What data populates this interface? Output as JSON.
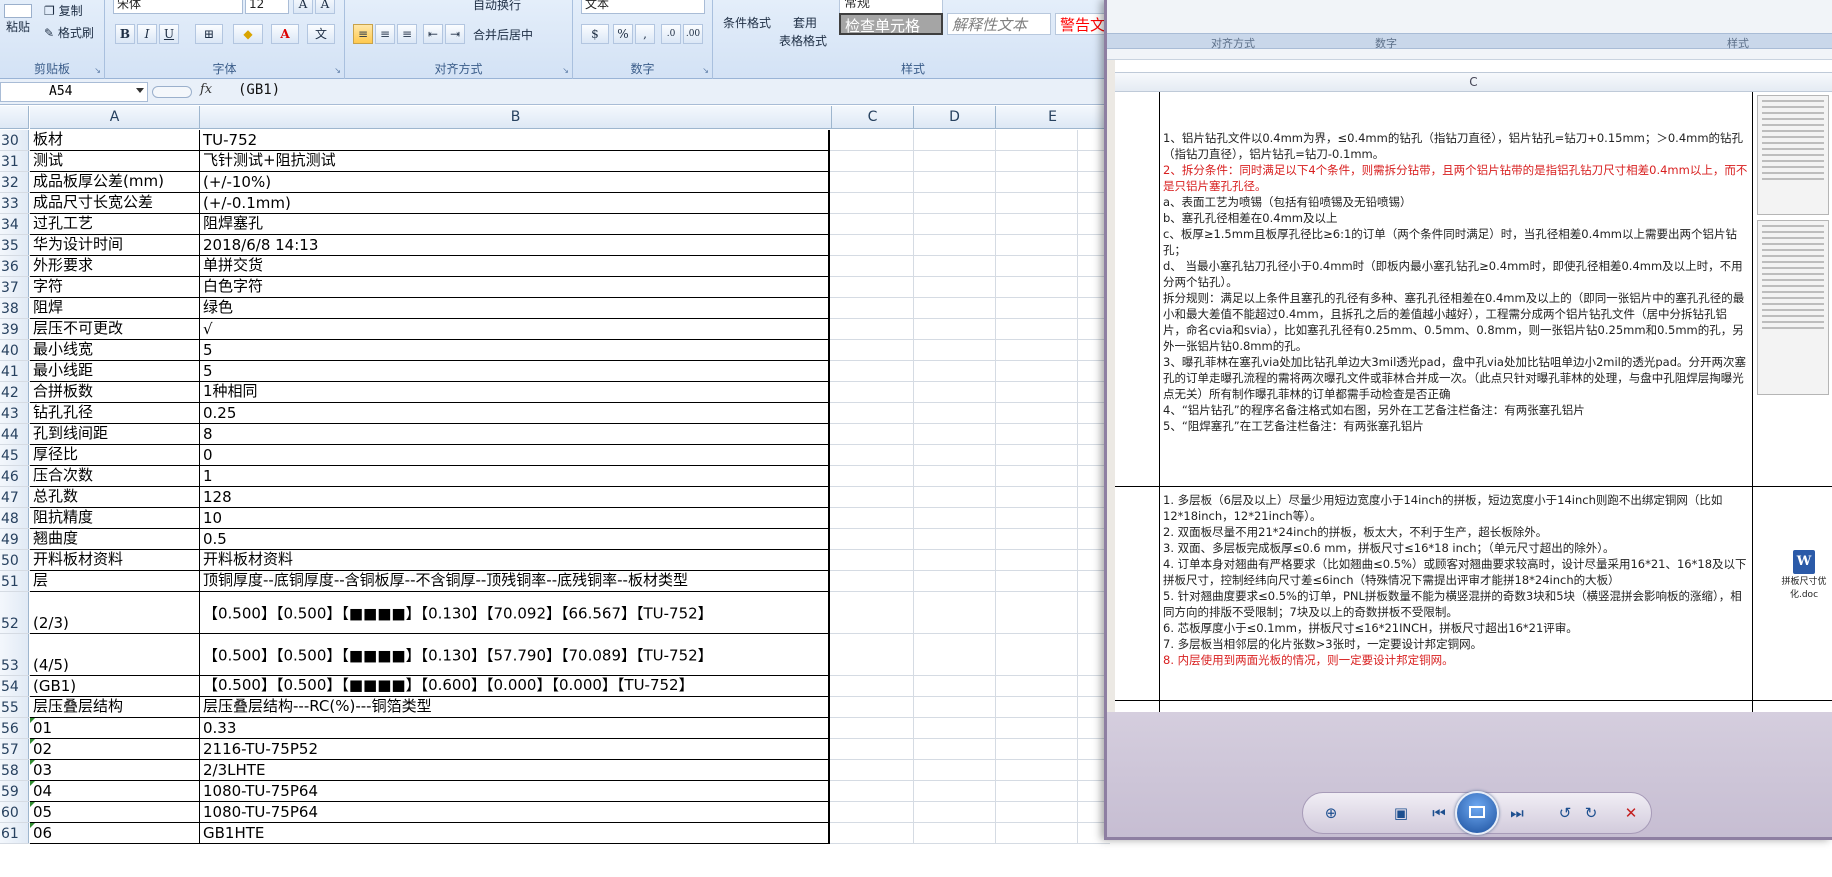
{
  "ribbon": {
    "font_name": "宋体",
    "font_size": "12",
    "number_format": "文本",
    "paste_label": "粘贴",
    "copy_label": "复制",
    "format_painter_label": "格式刷",
    "wrap_label": "自动换行",
    "merge_center_label": "合并后居中",
    "cond_format_label": "条件格式",
    "table_format_label": "套用",
    "table_format_label2": "表格格式",
    "style_normal": "常规",
    "style_check_cell": "检查单元格",
    "style_explanatory": "解释性文本",
    "style_warning": "警告文",
    "groups": {
      "clipboard": "剪贴板",
      "font": "字体",
      "alignment": "对齐方式",
      "number": "数字",
      "styles": "样式"
    },
    "bold": "B",
    "italic": "I",
    "underline": "U",
    "percent": "%",
    "comma": ","
  },
  "formula_bar": {
    "cell_ref": "A54",
    "fx": "fx",
    "content": "(GB1)"
  },
  "columns": [
    "A",
    "B",
    "C",
    "D",
    "E"
  ],
  "rows": [
    {
      "n": "30",
      "a": "板材",
      "b": "TU-752"
    },
    {
      "n": "31",
      "a": "测试",
      "b": "飞针测试+阻抗测试"
    },
    {
      "n": "32",
      "a": "成品板厚公差(mm)",
      "b": "(+/-10%)"
    },
    {
      "n": "33",
      "a": "成品尺寸长宽公差",
      "b": "(+/-0.1mm)"
    },
    {
      "n": "34",
      "a": "过孔工艺",
      "b": "阻焊塞孔"
    },
    {
      "n": "35",
      "a": "华为设计时间",
      "b": "2018/6/8 14:13"
    },
    {
      "n": "36",
      "a": "外形要求",
      "b": "单拼交货"
    },
    {
      "n": "37",
      "a": "字符",
      "b": "白色字符"
    },
    {
      "n": "38",
      "a": "阻焊",
      "b": "绿色"
    },
    {
      "n": "39",
      "a": "层压不可更改",
      "b": "√"
    },
    {
      "n": "40",
      "a": "最小线宽",
      "b": "5"
    },
    {
      "n": "41",
      "a": "最小线距",
      "b": "5"
    },
    {
      "n": "42",
      "a": "合拼板数",
      "b": "1种相同"
    },
    {
      "n": "43",
      "a": "钻孔孔径",
      "b": "0.25"
    },
    {
      "n": "44",
      "a": "孔到线间距",
      "b": "8"
    },
    {
      "n": "45",
      "a": "厚径比",
      "b": "0"
    },
    {
      "n": "46",
      "a": "压合次数",
      "b": "1"
    },
    {
      "n": "47",
      "a": "总孔数",
      "b": "128"
    },
    {
      "n": "48",
      "a": "阻抗精度",
      "b": "10"
    },
    {
      "n": "49",
      "a": "翘曲度",
      "b": "0.5"
    },
    {
      "n": "50",
      "a": "开料板材资料",
      "b": "开料板材资料"
    },
    {
      "n": "51",
      "a": "层",
      "b": "顶铜厚度--底铜厚度--含铜板厚--不含铜厚--顶残铜率--底残铜率--板材类型"
    },
    {
      "n": "52",
      "a": "(2/3)",
      "b": "【0.500】【0.500】【■■■■】【0.130】【70.092】【66.567】【TU-752】",
      "tall": true
    },
    {
      "n": "53",
      "a": "(4/5)",
      "b": "【0.500】【0.500】【■■■■】【0.130】【57.790】【70.089】【TU-752】",
      "tall": true
    },
    {
      "n": "54",
      "a": "(GB1)",
      "b": "【0.500】【0.500】【■■■■】【0.600】【0.000】【0.000】【TU-752】"
    },
    {
      "n": "55",
      "a": "层压叠层结构",
      "b": "层压叠层结构---RC(%)---铜箔类型"
    },
    {
      "n": "56",
      "a": "01",
      "b": "0.33",
      "tri": true
    },
    {
      "n": "57",
      "a": "02",
      "b": "2116-TU-75P52",
      "tri": true
    },
    {
      "n": "58",
      "a": "03",
      "b": "2/3LHTE",
      "tri": true
    },
    {
      "n": "59",
      "a": "04",
      "b": "1080-TU-75P64",
      "tri": true
    },
    {
      "n": "60",
      "a": "05",
      "b": "1080-TU-75P64",
      "tri": true
    },
    {
      "n": "61",
      "a": "06",
      "b": "GB1HTE",
      "tri": true
    }
  ],
  "viewer": {
    "strip_labels": [
      "对齐方式",
      "数字",
      "样式"
    ],
    "col_header": "C",
    "block1": [
      {
        "t": "1、铝片钻孔文件以0.4mm为界，≤0.4mm的钻孔（指钻刀直径），铝片钻孔=钻刀+0.15mm；＞0.4mm的钻孔（指钻刀直径），铝片钻孔=钻刀-0.1mm。",
        "red": false
      },
      {
        "t": "2、拆分条件：同时满足以下4个条件，则需拆分钻带，且两个铝片钻带的是指铝孔钻刀尺寸相差0.4mm以上，而不是只铝片塞孔孔径。",
        "red": true
      },
      {
        "t": "a、表面工艺为喷锡（包括有铅喷锡及无铅喷锡）",
        "red": false
      },
      {
        "t": "b、塞孔孔径相差在0.4mm及以上",
        "red": false
      },
      {
        "t": "c、板厚≥1.5mm且板厚孔径比≥6:1的订单（两个条件同时满足）时，当孔径相差0.4mm以上需要出两个铝片钻孔；",
        "red": false
      },
      {
        "t": "d、 当最小塞孔钻刀孔径小于0.4mm时（即板内最小塞孔钻孔≥0.4mm时，即使孔径相差0.4mm及以上时，不用分两个钻孔）。",
        "red": false
      },
      {
        "t": "拆分规则：满足以上条件且塞孔的孔径有多种、塞孔孔径相差在0.4mm及以上的（即同一张铝片中的塞孔孔径的最小和最大差值不能超过0.4mm，且拆孔之后的差值越小越好），工程需分成两个铝片钻孔文件（居中分拆钻孔铝片，命名cvia和svia），比如塞孔孔径有0.25mm、0.5mm、0.8mm，则一张铝片钻0.25mm和0.5mm的孔，另外一张铝片钻0.8mm的孔。",
        "red": false
      },
      {
        "t": "3、曝孔菲林在塞孔via处加比钻孔单边大3mil透光pad，盘中孔via处加比钻咀单边小2mil的透光pad。分开两次塞孔的订单走曝孔流程的需将两次曝孔文件或菲林合并成一次。（此点只针对曝孔菲林的处理，与盘中孔阻焊层掏曝光点无关）所有制作曝孔菲林的订单都需手动检查是否正确",
        "red": false
      },
      {
        "t": " ",
        "red": false
      },
      {
        "t": "4、“铝片钻孔”的程序名备注格式如右图，另外在工艺备注栏备注：有两张塞孔铝片",
        "red": false
      },
      {
        "t": "5、“阻焊塞孔”在工艺备注栏备注：有两张塞孔铝片",
        "red": false
      }
    ],
    "block2": [
      {
        "t": "1. 多层板（6层及以上）尽量少用短边宽度小于14inch的拼板，短边宽度小于14inch则跑不出绑定铜网（比如12*18inch，12*21inch等）。",
        "red": false
      },
      {
        "t": "2. 双面板尽量不用21*24inch的拼板，板太大，不利于生产，超长板除外。",
        "red": false
      },
      {
        "t": "3. 双面、多层板完成板厚≤0.6 mm，拼板尺寸≤16*18 inch；（单元尺寸超出的除外）。",
        "red": false
      },
      {
        "t": "4. 订单本身对翘曲有严格要求（比如翘曲≤0.5%）或顾客对翘曲要求较高时，设计尽量采用16*21、16*18及以下拼板尺寸，控制经纬向尺寸差≤6inch（特殊情况下需提出评审才能拼18*24inch的大板）",
        "red": false
      },
      {
        "t": "5. 针对翘曲度要求≤0.5%的订单，PNL拼板数量不能为横竖混拼的奇数3块和5块（横竖混拼会影响板的涨缩），相同方向的排版不受限制；7块及以上的奇数拼板不受限制。",
        "red": false
      },
      {
        "t": "6. 芯板厚度小于≤0.1mm，拼板尺寸≤16*21INCH，拼板尺寸超出16*21评审。",
        "red": false
      },
      {
        "t": "7. 多层板当相邻层的化片张数>3张时，一定要设计邦定铜网。",
        "red": false
      },
      {
        "t": "8. 内层使用到两面光板的情况，则一定要设计邦定铜网。",
        "red": true
      }
    ],
    "doc_icon_label": "拼板尺寸优化.doc",
    "doc_icon_glyph": "W"
  },
  "colors": {
    "accent": "#1b4f9c",
    "red_text": "#d81f1f",
    "grid_border": "#000000"
  }
}
